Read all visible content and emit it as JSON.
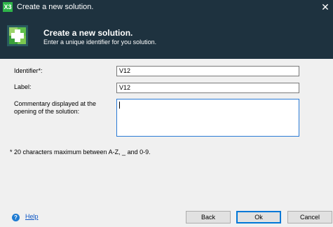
{
  "window": {
    "app_icon": "X3",
    "title": "Create a new solution.",
    "close": "✕"
  },
  "banner": {
    "logo_icon": "green-plus-cross-icon",
    "title": "Create a new solution.",
    "subtitle": "Enter a unique identifier for you solution."
  },
  "form": {
    "identifier_label": "Identifier*:",
    "identifier_value": "V12",
    "label_label": "Label:",
    "label_value": "V12",
    "commentary_label_line1": "Commentary displayed at the",
    "commentary_label_line2": "opening of the solution:",
    "commentary_value": ""
  },
  "note": "* 20 characters maximum between A-Z, _ and 0-9.",
  "footer": {
    "help_icon": "?",
    "help_label": "Help",
    "back_label": "Back",
    "ok_label": "Ok",
    "cancel_label": "Cancel"
  },
  "colors": {
    "header_bg": "#1e323f",
    "app_icon_green": "#2fb54a",
    "focus_blue": "#0078d7"
  }
}
